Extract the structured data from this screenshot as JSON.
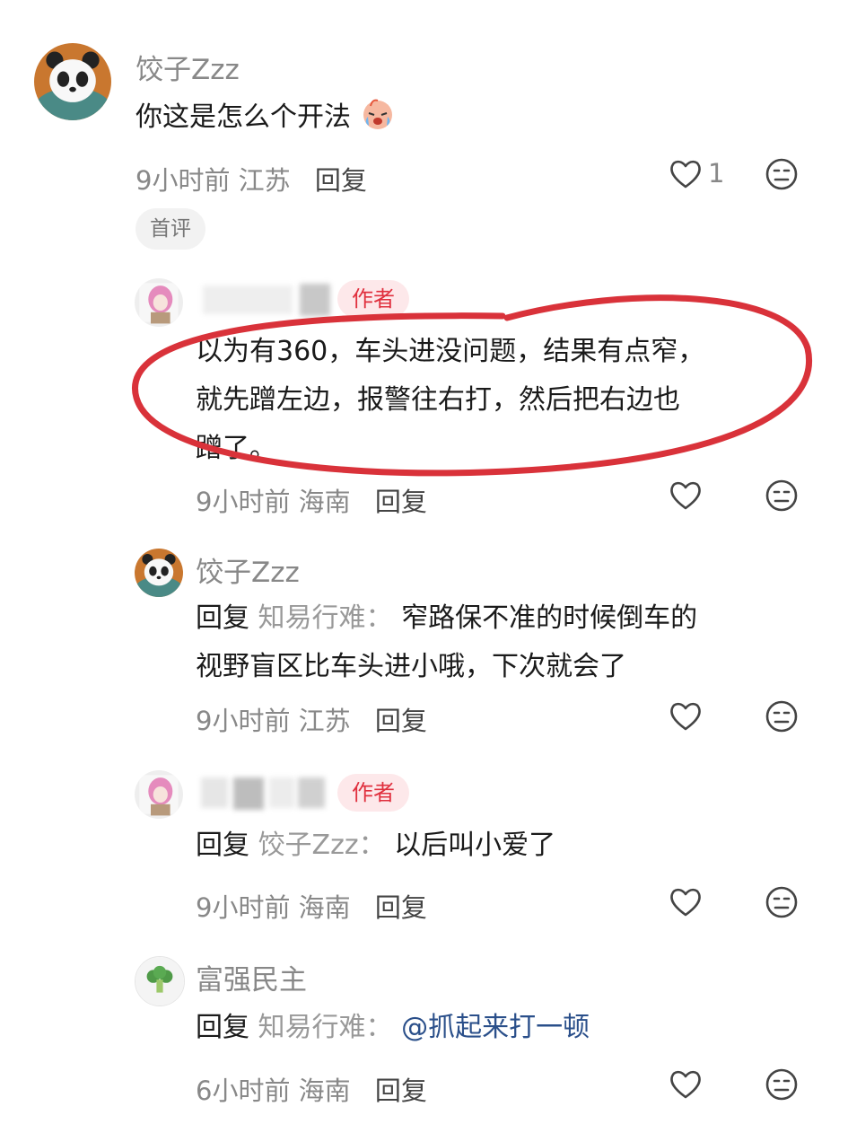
{
  "comments": [
    {
      "user": "饺子Zzz",
      "text": "你这是怎么个开法",
      "time": "9小时前",
      "location": "江苏",
      "reply_label": "回复",
      "likes": "1",
      "tag": "首评",
      "emoji": "crying-face-emoji"
    },
    {
      "badge": "作者",
      "text_lines": [
        "以为有360，车头进没问题，结果有点窄，",
        "就先蹭左边，报警往右打，然后把右边也",
        "蹭了。"
      ],
      "time": "9小时前",
      "location": "海南",
      "reply_label": "回复",
      "highlight_color": "#d9323a"
    },
    {
      "user": "饺子Zzz",
      "reply_prefix": "回复",
      "reply_to": "知易行难：",
      "text_lines": [
        "窄路保不准的时候倒车的",
        "视野盲区比车头进小哦，下次就会了"
      ],
      "time": "9小时前",
      "location": "江苏",
      "reply_label": "回复"
    },
    {
      "badge": "作者",
      "reply_prefix": "回复",
      "reply_to": "饺子Zzz：",
      "text": "以后叫小爱了",
      "time": "9小时前",
      "location": "海南",
      "reply_label": "回复"
    },
    {
      "user": "富强民主",
      "reply_prefix": "回复",
      "reply_to": "知易行难：",
      "text": "@抓起来打一顿",
      "time": "6小时前",
      "location": "海南",
      "reply_label": "回复"
    }
  ],
  "icons": {
    "heart": "heart-outline-icon",
    "face": "neutral-face-icon"
  },
  "colors": {
    "author_badge_bg": "#fde8ea",
    "author_badge_text": "#e0303e",
    "mention": "#2a4f8a"
  }
}
